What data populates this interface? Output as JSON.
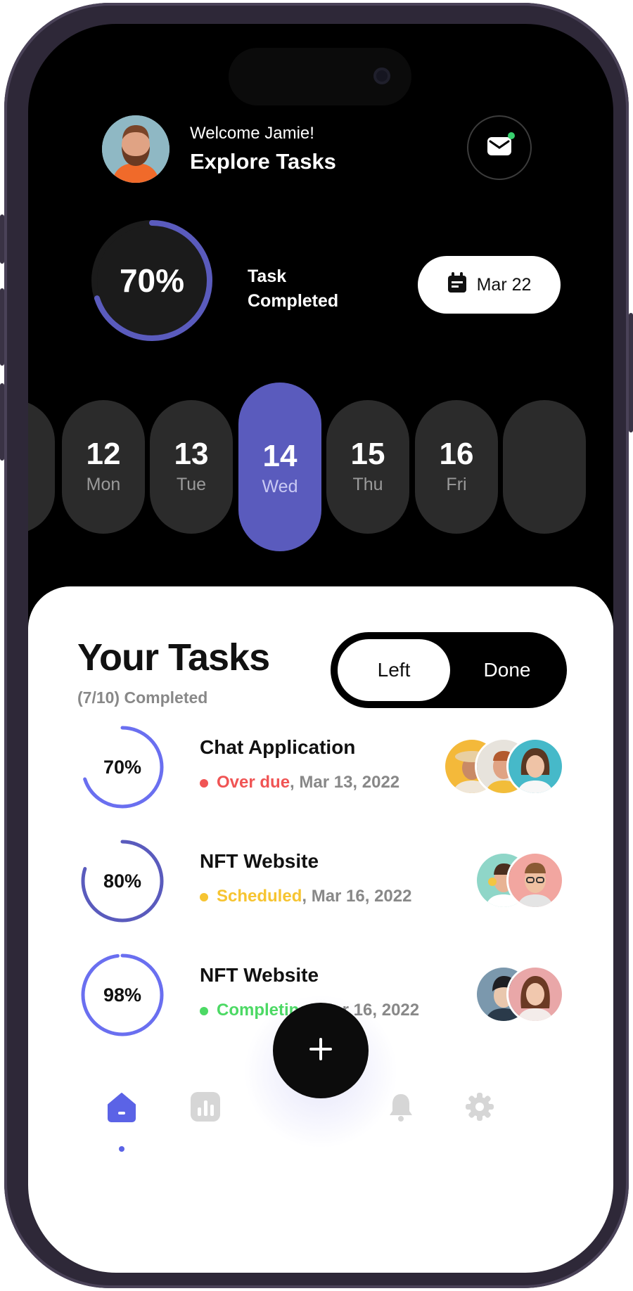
{
  "header": {
    "welcome": "Welcome Jamie!",
    "title": "Explore Tasks",
    "has_notification": true
  },
  "progress": {
    "percent_label": "70%",
    "percent": 70,
    "label": "Task Completed",
    "date": "Mar 22"
  },
  "days": [
    {
      "num": "12",
      "name": "Mon"
    },
    {
      "num": "13",
      "name": "Tue"
    },
    {
      "num": "14",
      "name": "Wed",
      "active": true
    },
    {
      "num": "15",
      "name": "Thu"
    },
    {
      "num": "16",
      "name": "Fri"
    }
  ],
  "tasks_section": {
    "title": "Your Tasks",
    "completed": "(7/10) Completed",
    "toggle": {
      "left": "Left",
      "done": "Done",
      "selected": "Left"
    }
  },
  "tasks": [
    {
      "percent_label": "70%",
      "percent": 70,
      "name": "Chat Application",
      "status": "Over due",
      "status_color": "#f05454",
      "date": ", Mar 13, 2022",
      "ring_color": "#6a6ff0"
    },
    {
      "percent_label": "80%",
      "percent": 80,
      "name": "NFT Website",
      "status": "Scheduled",
      "status_color": "#f6c431",
      "date": ", Mar 16, 2022",
      "ring_color": "#5a5bbd"
    },
    {
      "percent_label": "98%",
      "percent": 98,
      "name": "NFT Website",
      "status": "Completing",
      "status_color": "#4cd964",
      "date": ", Mar 16, 2022",
      "ring_color": "#6a6ff0"
    }
  ],
  "colors": {
    "accent": "#5a5bbd",
    "nav_active": "#5b63e6",
    "nav_inactive": "#d6d6d6"
  },
  "nav": [
    "home-icon",
    "chart-icon",
    "bell-icon",
    "gear-icon"
  ]
}
